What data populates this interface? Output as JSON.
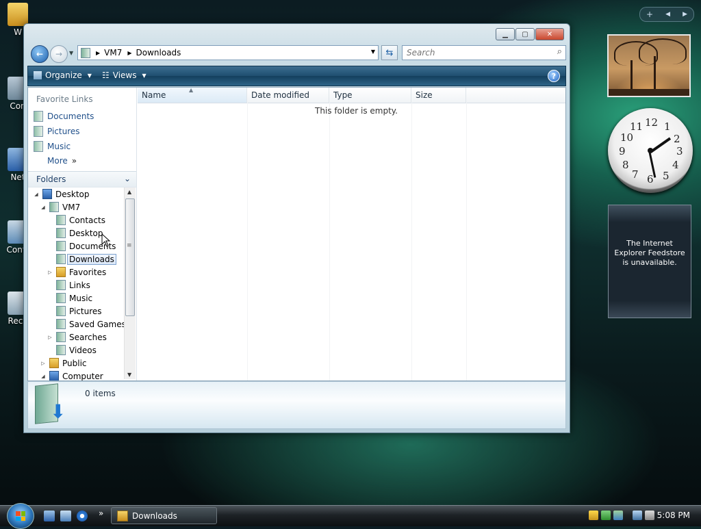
{
  "desktop": {
    "icons": [
      {
        "label": "W"
      },
      {
        "label": "Con"
      },
      {
        "label": "Net"
      },
      {
        "label": "Contr"
      },
      {
        "label": "Recy"
      }
    ]
  },
  "window": {
    "title": "",
    "address": {
      "crumbs": [
        "VM7",
        "Downloads"
      ]
    },
    "search": {
      "placeholder": "Search"
    },
    "toolbar": {
      "organize": "Organize",
      "views": "Views"
    },
    "favorite_links": {
      "title": "Favorite Links",
      "items": [
        "Documents",
        "Pictures",
        "Music"
      ],
      "more": "More"
    },
    "folders": {
      "title": "Folders",
      "tree": [
        {
          "label": "Desktop",
          "level": 0
        },
        {
          "label": "VM7",
          "level": 1
        },
        {
          "label": "Contacts",
          "level": 2
        },
        {
          "label": "Desktop",
          "level": 2
        },
        {
          "label": "Documents",
          "level": 2
        },
        {
          "label": "Downloads",
          "level": 2,
          "selected": true
        },
        {
          "label": "Favorites",
          "level": 2
        },
        {
          "label": "Links",
          "level": 2
        },
        {
          "label": "Music",
          "level": 2
        },
        {
          "label": "Pictures",
          "level": 2
        },
        {
          "label": "Saved Games",
          "level": 2
        },
        {
          "label": "Searches",
          "level": 2
        },
        {
          "label": "Videos",
          "level": 2
        },
        {
          "label": "Public",
          "level": 1
        },
        {
          "label": "Computer",
          "level": 1
        }
      ]
    },
    "columns": [
      "Name",
      "Date modified",
      "Type",
      "Size"
    ],
    "empty_message": "This folder is empty.",
    "details": {
      "count": "0 items"
    }
  },
  "sidebar": {
    "feed_message": "The Internet Explorer Feedstore is unavailable."
  },
  "taskbar": {
    "button_label": "Downloads",
    "time": "5:08 PM"
  },
  "colors": {
    "accent": "#1f4f8a",
    "selection": "#dbe8f8",
    "close": "#c9472d"
  }
}
